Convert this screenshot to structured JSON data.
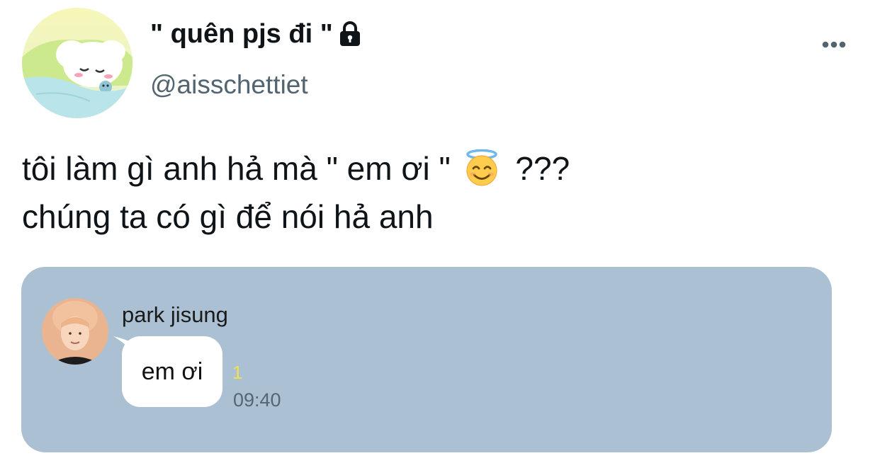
{
  "tweet": {
    "author": {
      "display_name": "\" quên pjs đi \"",
      "handle": "@aisschettiet",
      "protected_icon": "lock-icon",
      "avatar_icon": "sleeping-bunny-avatar"
    },
    "more_icon": "more-horizontal-icon",
    "text_lines": {
      "line1_before_emoji": "tôi làm gì anh hả mà \" em ơi \"",
      "emoji": "smiling-face-with-halo",
      "line1_after_emoji": "???",
      "line2": "chúng ta có gì để nói hả anh"
    }
  },
  "attached_chat": {
    "background_color": "#abc1d3",
    "sender": {
      "name": "park jisung",
      "avatar_icon": "profile-photo"
    },
    "message": {
      "text": "em ơi",
      "unread_count": "1",
      "time": "09:40"
    },
    "colors": {
      "unread": "#f0e04c",
      "bubble": "#ffffff"
    }
  }
}
